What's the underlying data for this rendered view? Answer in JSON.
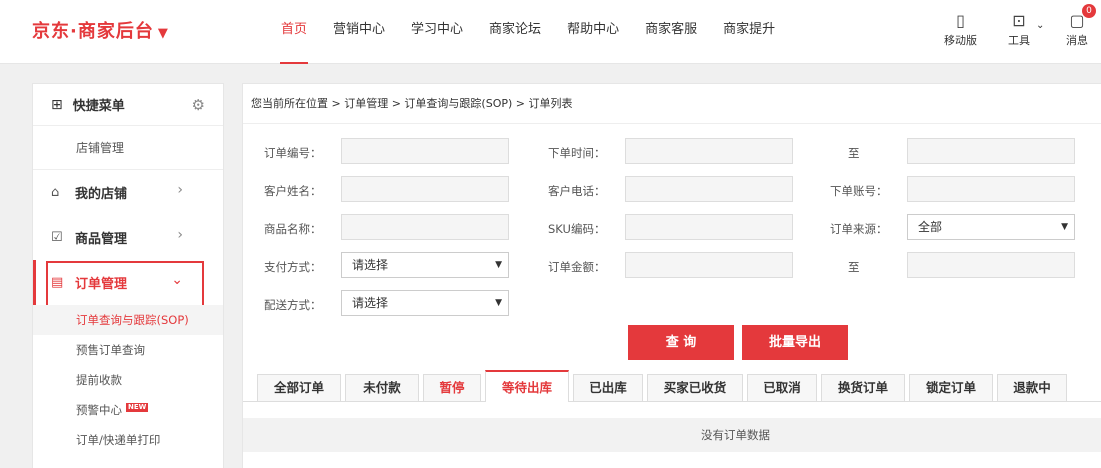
{
  "header": {
    "logo": "京东·商家后台",
    "logo_caret": "▼",
    "nav": [
      "首页",
      "营销中心",
      "学习中心",
      "商家论坛",
      "帮助中心",
      "商家客服",
      "商家提升"
    ],
    "tools": {
      "mobile": "移动版",
      "tool": "工具",
      "message": "消息",
      "message_count": "0"
    }
  },
  "sidebar": {
    "quick_menu": "快捷菜单",
    "shop_manage": "店铺管理",
    "groups": {
      "my_shop": "我的店铺",
      "product": "商品管理",
      "order": "订单管理"
    },
    "sub_items": [
      "订单查询与跟踪(SOP)",
      "预售订单查询",
      "提前收款",
      "预警中心",
      "订单/快递单打印"
    ],
    "new_tag": "NEW"
  },
  "main": {
    "breadcrumb": "您当前所在位置 > 订单管理 > 订单查询与跟踪(SOP) > 订单列表",
    "form": {
      "order_no": "订单编号：",
      "order_time": "下单时间：",
      "to1": "至",
      "customer_name": "客户姓名：",
      "customer_phone": "客户电话：",
      "order_account": "下单账号：",
      "product_name": "商品名称：",
      "sku": "SKU编码：",
      "order_source": "订单来源：",
      "order_source_value": "全部",
      "pay_method": "支付方式：",
      "pay_method_value": "请选择",
      "order_amount": "订单金额：",
      "to2": "至",
      "delivery": "配送方式：",
      "delivery_value": "请选择"
    },
    "buttons": {
      "query": "查 询",
      "export": "批量导出"
    },
    "tabs": [
      "全部订单",
      "未付款",
      "暂停",
      "等待出库",
      "已出库",
      "买家已收货",
      "已取消",
      "换货订单",
      "锁定订单",
      "退款中"
    ],
    "empty_text": "没有订单数据"
  }
}
